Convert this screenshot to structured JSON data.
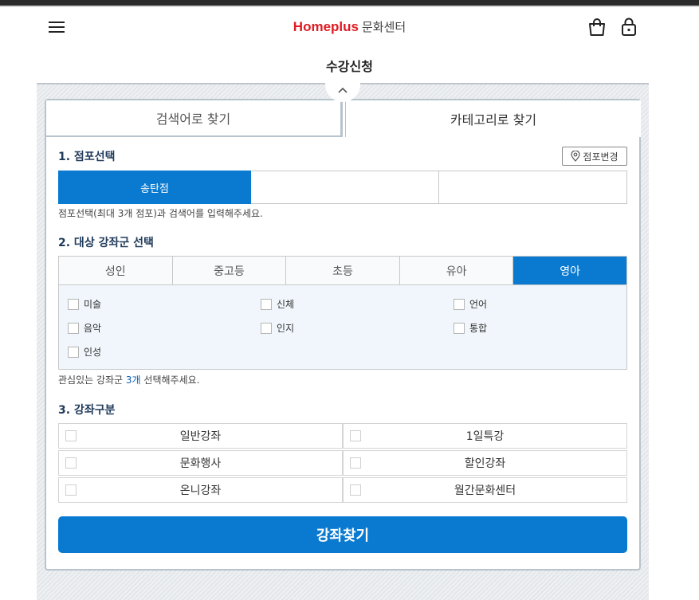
{
  "header": {
    "brand": "Homeplus",
    "brand_sub": "문화센터",
    "menu_icon": "hamburger-menu-icon",
    "cart_icon": "shopping-bag-icon",
    "lock_icon": "lock-icon",
    "brand_color": "#e11b22"
  },
  "page": {
    "title": "수강신청"
  },
  "tabs": [
    {
      "label": "검색어로 찾기",
      "active": false
    },
    {
      "label": "카테고리로 찾기",
      "active": true
    }
  ],
  "section1": {
    "title": "1. 점포선택",
    "change_button": "점포변경",
    "stores": [
      "송탄점",
      "",
      ""
    ],
    "hint": "점포선택(최대 3개 점포)과 검색어를 입력해주세요."
  },
  "section2": {
    "title": "2. 대상 강좌군 선택",
    "groups": [
      "성인",
      "중고등",
      "초등",
      "유아",
      "영아"
    ],
    "active_group": "영아",
    "categories": [
      "미술",
      "신체",
      "언어",
      "음악",
      "인지",
      "통합",
      "인성"
    ],
    "hint_prefix": "관심있는 강좌군 ",
    "hint_count": "3개",
    "hint_suffix": " 선택해주세요."
  },
  "section3": {
    "title": "3. 강좌구분",
    "types": [
      "일반강좌",
      "1일특강",
      "문화행사",
      "할인강좌",
      "온니강좌",
      "월간문화센터"
    ]
  },
  "search_button": "강좌찾기",
  "colors": {
    "accent": "#0a7ad0",
    "heading": "#1f3a5a"
  }
}
